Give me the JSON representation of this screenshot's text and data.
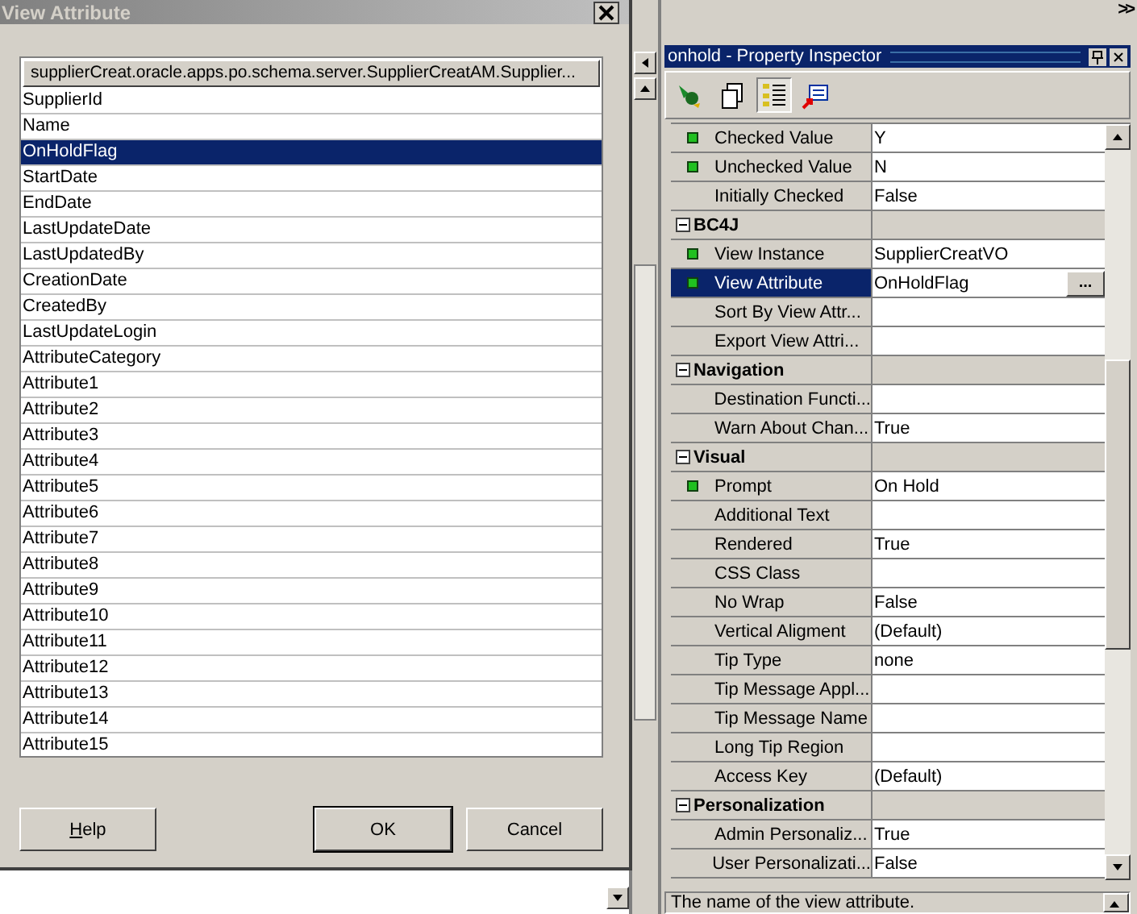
{
  "dialog": {
    "title": "View Attribute",
    "list": {
      "header": "supplierCreat.oracle.apps.po.schema.server.SupplierCreatAM.Supplier...",
      "items": [
        {
          "label": "SupplierId",
          "selected": false
        },
        {
          "label": "Name",
          "selected": false
        },
        {
          "label": "OnHoldFlag",
          "selected": true
        },
        {
          "label": "StartDate",
          "selected": false
        },
        {
          "label": "EndDate",
          "selected": false
        },
        {
          "label": "LastUpdateDate",
          "selected": false
        },
        {
          "label": "LastUpdatedBy",
          "selected": false
        },
        {
          "label": "CreationDate",
          "selected": false
        },
        {
          "label": "CreatedBy",
          "selected": false
        },
        {
          "label": "LastUpdateLogin",
          "selected": false
        },
        {
          "label": "AttributeCategory",
          "selected": false
        },
        {
          "label": "Attribute1",
          "selected": false
        },
        {
          "label": "Attribute2",
          "selected": false
        },
        {
          "label": "Attribute3",
          "selected": false
        },
        {
          "label": "Attribute4",
          "selected": false
        },
        {
          "label": "Attribute5",
          "selected": false
        },
        {
          "label": "Attribute6",
          "selected": false
        },
        {
          "label": "Attribute7",
          "selected": false
        },
        {
          "label": "Attribute8",
          "selected": false
        },
        {
          "label": "Attribute9",
          "selected": false
        },
        {
          "label": "Attribute10",
          "selected": false
        },
        {
          "label": "Attribute11",
          "selected": false
        },
        {
          "label": "Attribute12",
          "selected": false
        },
        {
          "label": "Attribute13",
          "selected": false
        },
        {
          "label": "Attribute14",
          "selected": false
        },
        {
          "label": "Attribute15",
          "selected": false
        }
      ]
    },
    "buttons": [
      {
        "label": "Help",
        "default": false,
        "mnemonic": true
      },
      {
        "label": "OK",
        "default": true,
        "mnemonic": false
      },
      {
        "label": "Cancel",
        "default": false,
        "mnemonic": false
      }
    ]
  },
  "overflow": ">>",
  "inspector": {
    "title": "onhold - Property Inspector",
    "toolbar": [
      {
        "selected": false
      },
      {
        "selected": false
      },
      {
        "selected": true
      },
      {
        "selected": false
      }
    ],
    "rows": [
      {
        "kind": "property",
        "name": "Checked Value",
        "value": "Y",
        "bound": true,
        "selected": false
      },
      {
        "kind": "property",
        "name": "Unchecked Value",
        "value": "N",
        "bound": true,
        "selected": false
      },
      {
        "kind": "property",
        "name": "Initially Checked",
        "value": "False",
        "bound": false,
        "selected": false
      },
      {
        "kind": "category",
        "name": "BC4J",
        "expanded": true
      },
      {
        "kind": "property",
        "name": "View Instance",
        "value": "SupplierCreatVO",
        "bound": true,
        "selected": false
      },
      {
        "kind": "property",
        "name": "View Attribute",
        "value": "OnHoldFlag",
        "bound": true,
        "selected": true,
        "button": "..."
      },
      {
        "kind": "property",
        "name": "Sort By View Attr...",
        "bound": false,
        "selected": false
      },
      {
        "kind": "property",
        "name": "Export View Attri...",
        "bound": false,
        "selected": false
      },
      {
        "kind": "category",
        "name": "Navigation",
        "expanded": true
      },
      {
        "kind": "property",
        "name": "Destination Functi...",
        "bound": false,
        "selected": false
      },
      {
        "kind": "property",
        "name": "Warn About Chan...",
        "value": "True",
        "bound": false,
        "selected": false
      },
      {
        "kind": "category",
        "name": "Visual",
        "expanded": true
      },
      {
        "kind": "property",
        "name": "Prompt",
        "value": "On Hold",
        "bound": true,
        "selected": false
      },
      {
        "kind": "property",
        "name": "Additional Text",
        "bound": false,
        "selected": false
      },
      {
        "kind": "property",
        "name": "Rendered",
        "value": "True",
        "bound": false,
        "selected": false
      },
      {
        "kind": "property",
        "name": "CSS Class",
        "bound": false,
        "selected": false
      },
      {
        "kind": "property",
        "name": "No Wrap",
        "value": "False",
        "bound": false,
        "selected": false
      },
      {
        "kind": "property",
        "name": "Vertical Aligment",
        "value": "(Default)",
        "bound": false,
        "selected": false
      },
      {
        "kind": "property",
        "name": "Tip Type",
        "value": "none",
        "bound": false,
        "selected": false
      },
      {
        "kind": "property",
        "name": "Tip Message Appl...",
        "bound": false,
        "selected": false
      },
      {
        "kind": "property",
        "name": "Tip Message Name",
        "bound": false,
        "selected": false
      },
      {
        "kind": "property",
        "name": "Long Tip Region",
        "bound": false,
        "selected": false
      },
      {
        "kind": "property",
        "name": "Access Key",
        "value": "(Default)",
        "bound": false,
        "selected": false
      },
      {
        "kind": "category",
        "name": "Personalization",
        "expanded": true
      },
      {
        "kind": "property",
        "name": "Admin Personaliz...",
        "value": "True",
        "bound": false,
        "selected": false
      },
      {
        "kind": "property",
        "name": "User Personalizati...",
        "value": "False",
        "bound": false,
        "selected": false
      }
    ],
    "description": "The name of the view attribute."
  }
}
